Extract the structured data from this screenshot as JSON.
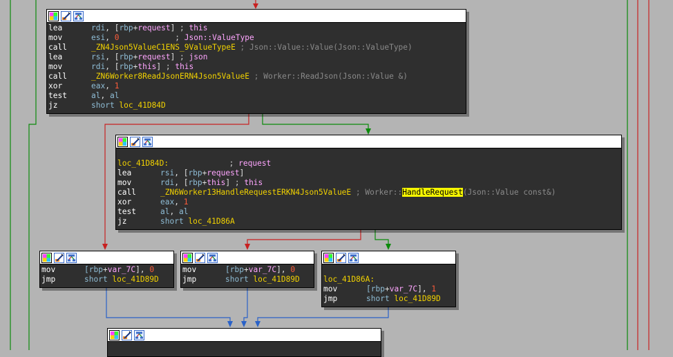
{
  "colors": {
    "background": "#b4b4b4",
    "node_bg": "#2f2f2f",
    "edge_true": "#0b8a0b",
    "edge_false": "#c82020",
    "edge_uncond": "#2a62c8",
    "highlight": "#f5f500"
  },
  "header_icons": [
    "color-palette-icon",
    "rename-edit-icon",
    "graph-nodes-icon"
  ],
  "nodes": [
    {
      "id": "block1",
      "lines": [
        [
          [
            "mn",
            "lea"
          ],
          [
            "reg",
            "rdi"
          ],
          [
            "punc",
            ", ["
          ],
          [
            "reg",
            "rbp"
          ],
          [
            "punc",
            "+"
          ],
          [
            "arg",
            "request"
          ],
          [
            "punc",
            "]"
          ],
          [
            "kw",
            " ; "
          ],
          [
            "arg",
            "this"
          ]
        ],
        [
          [
            "mn",
            "mov"
          ],
          [
            "reg",
            "esi"
          ],
          [
            "punc",
            ", "
          ],
          [
            "num",
            "0"
          ],
          [
            "kw",
            "            ; "
          ],
          [
            "arg",
            "Json::ValueType"
          ]
        ],
        [
          [
            "mn",
            "call"
          ],
          [
            "func",
            "_ZN4Json5ValueC1ENS_9ValueTypeE"
          ],
          [
            "cmt",
            " ; Json::Value::Value(Json::ValueType)"
          ]
        ],
        [
          [
            "mn",
            "lea"
          ],
          [
            "reg",
            "rsi"
          ],
          [
            "punc",
            ", ["
          ],
          [
            "reg",
            "rbp"
          ],
          [
            "punc",
            "+"
          ],
          [
            "arg",
            "request"
          ],
          [
            "punc",
            "]"
          ],
          [
            "kw",
            " ; "
          ],
          [
            "arg",
            "json"
          ]
        ],
        [
          [
            "mn",
            "mov"
          ],
          [
            "reg",
            "rdi"
          ],
          [
            "punc",
            ", ["
          ],
          [
            "reg",
            "rbp"
          ],
          [
            "punc",
            "+"
          ],
          [
            "arg",
            "this"
          ],
          [
            "punc",
            "]"
          ],
          [
            "kw",
            " ; "
          ],
          [
            "arg",
            "this"
          ]
        ],
        [
          [
            "mn",
            "call"
          ],
          [
            "func",
            "_ZN6Worker8ReadJsonERN4Json5ValueE"
          ],
          [
            "cmt",
            " ; Worker::ReadJson(Json::Value &)"
          ]
        ],
        [
          [
            "mn",
            "xor"
          ],
          [
            "reg",
            "eax"
          ],
          [
            "punc",
            ", "
          ],
          [
            "num",
            "1"
          ]
        ],
        [
          [
            "mn",
            "test"
          ],
          [
            "reg",
            "al"
          ],
          [
            "punc",
            ", "
          ],
          [
            "reg",
            "al"
          ]
        ],
        [
          [
            "mn",
            "jz"
          ],
          [
            "reg",
            "short "
          ],
          [
            "loc",
            "loc_41D84D"
          ]
        ]
      ]
    },
    {
      "id": "block2",
      "lines": [
        [],
        [
          [
            "lbl",
            "loc_41D84D:"
          ],
          [
            "kw",
            "             ; "
          ],
          [
            "arg",
            "request"
          ]
        ],
        [
          [
            "mn",
            "lea"
          ],
          [
            "reg",
            "rsi"
          ],
          [
            "punc",
            ", ["
          ],
          [
            "reg",
            "rbp"
          ],
          [
            "punc",
            "+"
          ],
          [
            "arg",
            "request"
          ],
          [
            "punc",
            "]"
          ]
        ],
        [
          [
            "mn",
            "mov"
          ],
          [
            "reg",
            "rdi"
          ],
          [
            "punc",
            ", ["
          ],
          [
            "reg",
            "rbp"
          ],
          [
            "punc",
            "+"
          ],
          [
            "arg",
            "this"
          ],
          [
            "punc",
            "]"
          ],
          [
            "kw",
            " ; "
          ],
          [
            "arg",
            "this"
          ]
        ],
        [
          [
            "mn",
            "call"
          ],
          [
            "func",
            "_ZN6Worker13HandleRequestERKN4Json5ValueE"
          ],
          [
            "cmt",
            " ; Worker::"
          ],
          [
            "hl",
            "HandleRequest"
          ],
          [
            "cmt",
            "(Json::Value const&)"
          ]
        ],
        [
          [
            "mn",
            "xor"
          ],
          [
            "reg",
            "eax"
          ],
          [
            "punc",
            ", "
          ],
          [
            "num",
            "1"
          ]
        ],
        [
          [
            "mn",
            "test"
          ],
          [
            "reg",
            "al"
          ],
          [
            "punc",
            ", "
          ],
          [
            "reg",
            "al"
          ]
        ],
        [
          [
            "mn",
            "jz"
          ],
          [
            "reg",
            "short "
          ],
          [
            "loc",
            "loc_41D86A"
          ]
        ]
      ]
    },
    {
      "id": "block3",
      "lines": [
        [
          [
            "mn",
            "mov"
          ],
          [
            "reg",
            "[rbp"
          ],
          [
            "punc",
            "+"
          ],
          [
            "arg",
            "var_7C"
          ],
          [
            "punc",
            "], "
          ],
          [
            "num",
            "0"
          ]
        ],
        [
          [
            "mn",
            "jmp"
          ],
          [
            "reg",
            "short "
          ],
          [
            "loc",
            "loc_41D89D"
          ]
        ]
      ]
    },
    {
      "id": "block4",
      "lines": [
        [
          [
            "mn",
            "mov"
          ],
          [
            "reg",
            "[rbp"
          ],
          [
            "punc",
            "+"
          ],
          [
            "arg",
            "var_7C"
          ],
          [
            "punc",
            "], "
          ],
          [
            "num",
            "0"
          ]
        ],
        [
          [
            "mn",
            "jmp"
          ],
          [
            "reg",
            "short "
          ],
          [
            "loc",
            "loc_41D89D"
          ]
        ]
      ]
    },
    {
      "id": "block5",
      "lines": [
        [],
        [
          [
            "lbl",
            "loc_41D86A:"
          ]
        ],
        [
          [
            "mn",
            "mov"
          ],
          [
            "reg",
            "[rbp"
          ],
          [
            "punc",
            "+"
          ],
          [
            "arg",
            "var_7C"
          ],
          [
            "punc",
            "], "
          ],
          [
            "num",
            "1"
          ]
        ],
        [
          [
            "mn",
            "jmp"
          ],
          [
            "reg",
            "short "
          ],
          [
            "loc",
            "loc_41D89D"
          ]
        ]
      ]
    },
    {
      "id": "block6",
      "lines": []
    }
  ]
}
